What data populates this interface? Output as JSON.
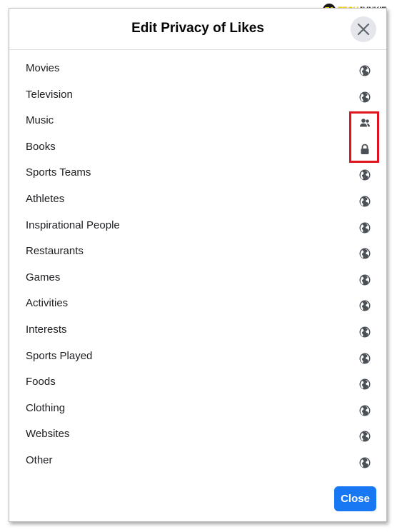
{
  "dialog": {
    "title": "Edit Privacy of Likes",
    "close_button_label": "Close"
  },
  "watermark": {
    "logo_text": "TJ",
    "brand_part1": "TECH",
    "brand_part2": "JUNKIE"
  },
  "categories": [
    {
      "label": "Movies",
      "icon": "globe-icon"
    },
    {
      "label": "Television",
      "icon": "globe-icon"
    },
    {
      "label": "Music",
      "icon": "friends-icon"
    },
    {
      "label": "Books",
      "icon": "lock-icon"
    },
    {
      "label": "Sports Teams",
      "icon": "globe-icon"
    },
    {
      "label": "Athletes",
      "icon": "globe-icon"
    },
    {
      "label": "Inspirational People",
      "icon": "globe-icon"
    },
    {
      "label": "Restaurants",
      "icon": "globe-icon"
    },
    {
      "label": "Games",
      "icon": "globe-icon"
    },
    {
      "label": "Activities",
      "icon": "globe-icon"
    },
    {
      "label": "Interests",
      "icon": "globe-icon"
    },
    {
      "label": "Sports Played",
      "icon": "globe-icon"
    },
    {
      "label": "Foods",
      "icon": "globe-icon"
    },
    {
      "label": "Clothing",
      "icon": "globe-icon"
    },
    {
      "label": "Websites",
      "icon": "globe-icon"
    },
    {
      "label": "Other",
      "icon": "globe-icon"
    }
  ],
  "colors": {
    "primary_button": "#1877f2",
    "highlight_box": "#e0141e",
    "icon": "#4b4f56",
    "text": "#1c1e21"
  }
}
